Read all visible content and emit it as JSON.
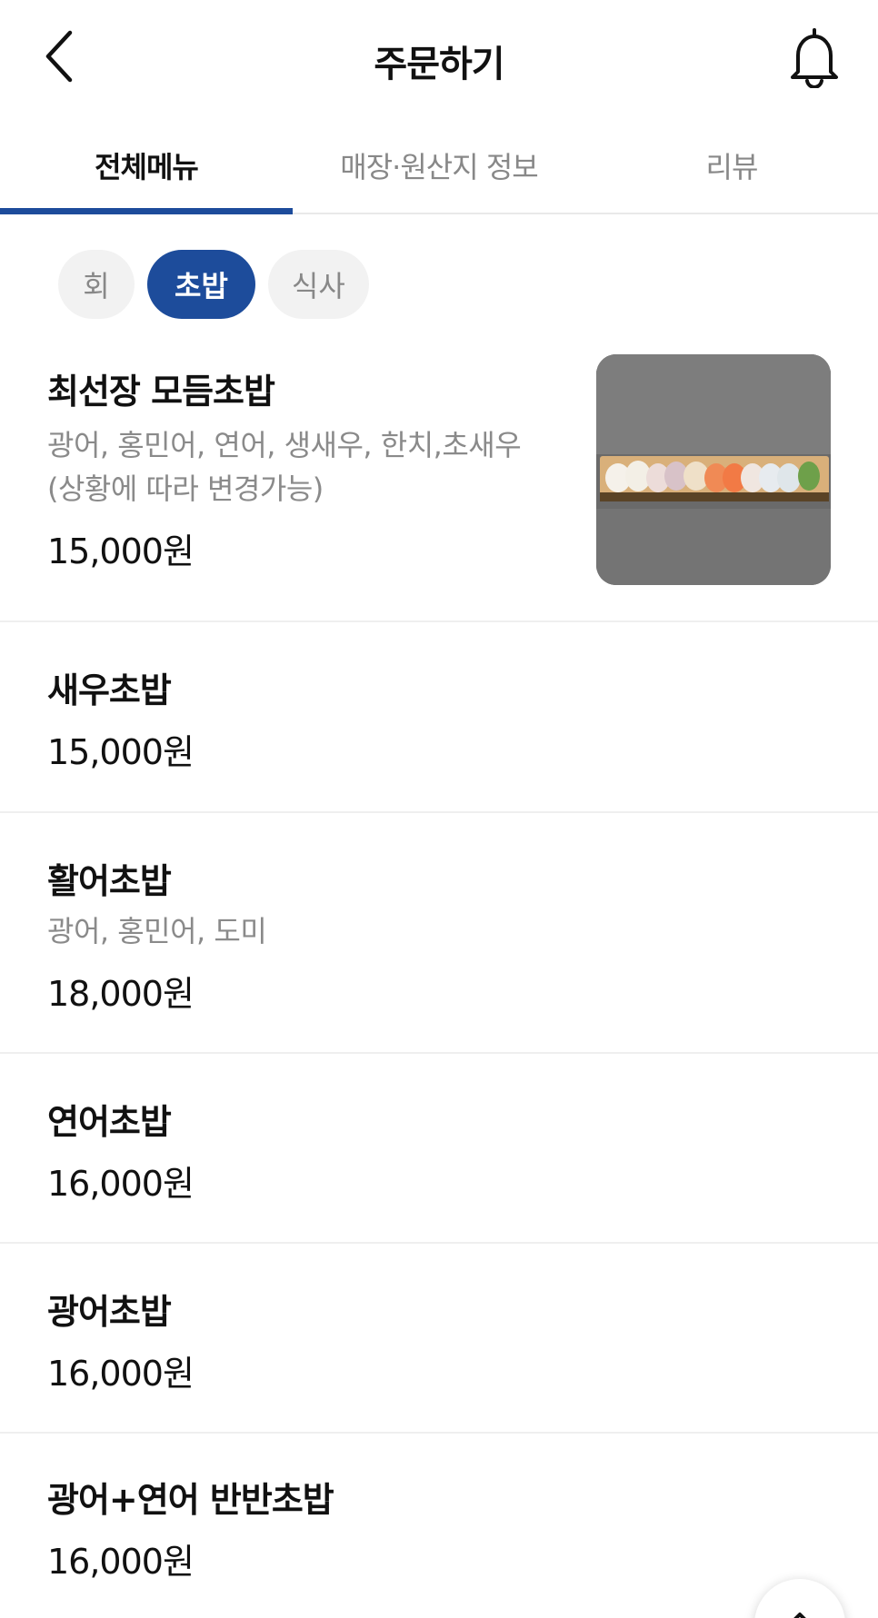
{
  "header": {
    "title": "주문하기"
  },
  "tabs": [
    {
      "label": "전체메뉴",
      "active": true
    },
    {
      "label": "매장·원산지 정보",
      "active": false
    },
    {
      "label": "리뷰",
      "active": false
    }
  ],
  "categories": [
    {
      "label": "회",
      "active": false
    },
    {
      "label": "초밥",
      "active": true
    },
    {
      "label": "식사",
      "active": false
    }
  ],
  "menu": [
    {
      "name": "최선장 모듬초밥",
      "desc": "광어, 홍민어, 연어, 생새우, 한치,초새우 (상황에 따라 변경가능)",
      "price": "15,000원"
    },
    {
      "name": "새우초밥",
      "desc": "",
      "price": "15,000원"
    },
    {
      "name": "활어초밥",
      "desc": "광어, 홍민어, 도미",
      "price": "18,000원"
    },
    {
      "name": "연어초밥",
      "desc": "",
      "price": "16,000원"
    },
    {
      "name": "광어초밥",
      "desc": "",
      "price": "16,000원"
    },
    {
      "name": "광어+연어 반반초밥",
      "desc": "",
      "price": "16,000원"
    }
  ],
  "colors": {
    "accent": "#1d4c9b",
    "muted_text": "#8a8a8a",
    "chip_bg": "#f2f2f2",
    "divider": "#efefef"
  },
  "icons": {
    "back": "chevron-left-icon",
    "bell": "bell-icon",
    "scroll_top": "chevron-up-icon"
  }
}
